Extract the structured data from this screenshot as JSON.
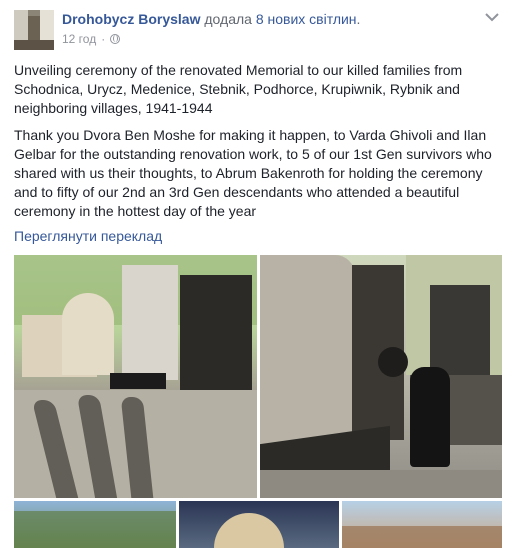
{
  "post": {
    "author": "Drohobycz Boryslaw",
    "action": "додала",
    "photos_link": "8 нових світлин",
    "punct": ".",
    "time": "12 год",
    "time_separator": "·",
    "paragraphs": [
      "Unveiling ceremony of the renovated Memorial to our killed families from Schodnica, Urycz, Medenice, Stebnik, Podhorce, Krupiwnik, Rybnik and neighboring villages, 1941-1944",
      "Thank you Dvora Ben Moshe for making it happen, to Varda Ghivoli and Ilan Gelbar for the outstanding renovation work, to 5 of our 1st Gen survivors who shared with us their thoughts, to Abrum Bakenroth for holding the ceremony and to fifty of our 2nd an 3rd Gen descendants who attended a beautiful ceremony in the hottest day of the year"
    ],
    "translate_link": "Переглянути переклад"
  },
  "colors": {
    "link": "#365899",
    "text": "#1d2129",
    "meta": "#90949c"
  },
  "icons": [
    "globe-icon",
    "chevron-down-icon"
  ]
}
